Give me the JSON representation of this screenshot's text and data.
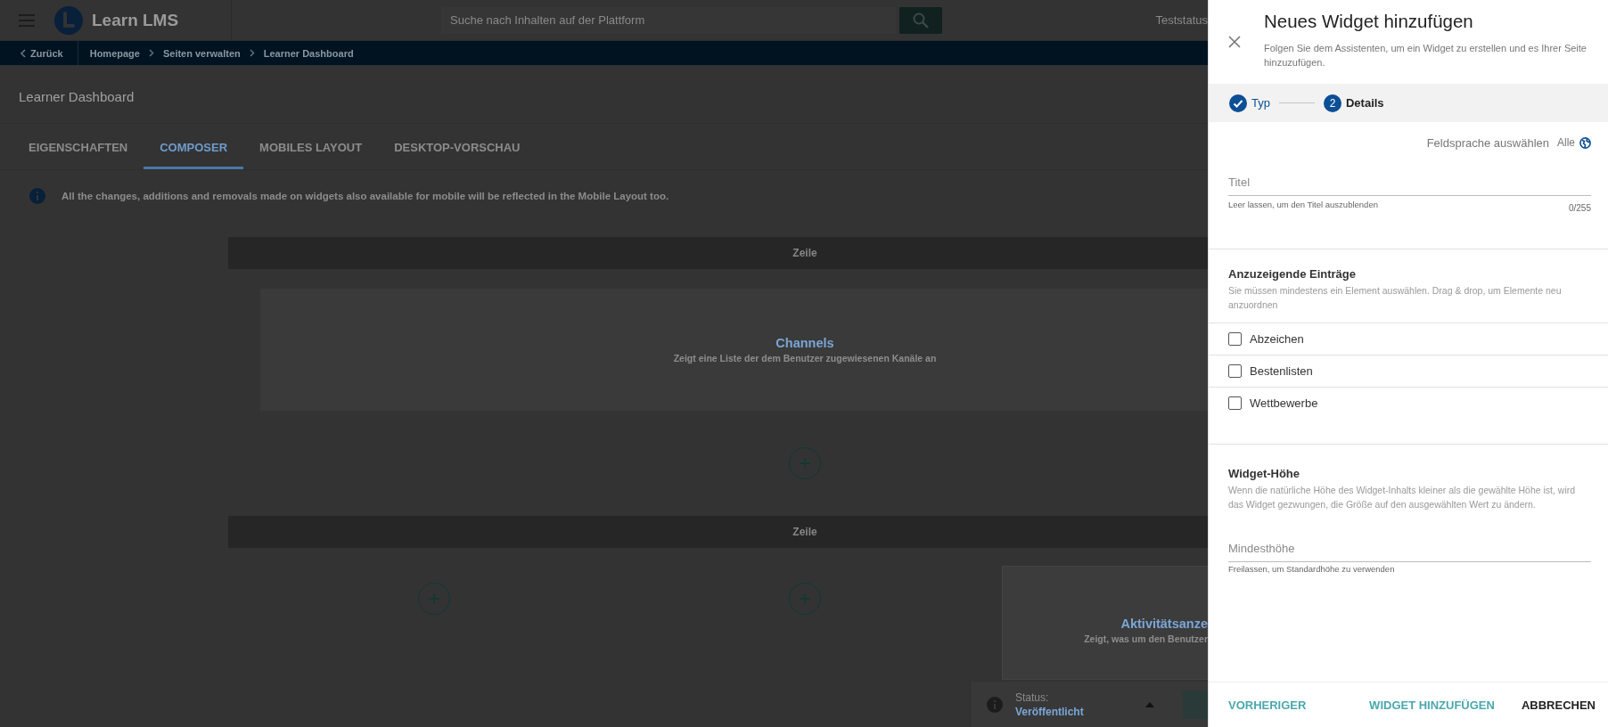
{
  "header": {
    "app_name": "Learn LMS",
    "search": {
      "placeholder": "Suche nach Inhalten auf der Plattform"
    },
    "user_status": "Teststatus"
  },
  "breadcrumb": {
    "back": "Zurück",
    "items": [
      "Homepage",
      "Seiten verwalten",
      "Learner Dashboard"
    ]
  },
  "page_title": "Learner Dashboard",
  "tabs": [
    {
      "label": "EIGENSCHAFTEN",
      "selected": false
    },
    {
      "label": "COMPOSER",
      "selected": true
    },
    {
      "label": "MOBILES LAYOUT",
      "selected": false
    },
    {
      "label": "DESKTOP-VORSCHAU",
      "selected": false
    }
  ],
  "info_message": "All the changes, additions and removals made on widgets also available for mobile will be reflected in the Mobile Layout too.",
  "rows": [
    {
      "label": "Zeile",
      "widget": {
        "title": "Channels",
        "description": "Zeigt eine Liste der dem Benutzer zugewiesenen Kanäle an"
      }
    },
    {
      "label": "Zeile",
      "widget": {
        "title": "Aktivitätsanze",
        "description": "Zeigt, was um den Benutzer"
      }
    }
  ],
  "status_bar": {
    "label": "Status:",
    "value": "Veröffentlicht"
  },
  "dialog": {
    "title": "Neues Widget hinzufügen",
    "subtitle": "Folgen Sie dem Assistenten, um ein Widget zu erstellen und es Ihrer Seite hinzuzufügen.",
    "steps": [
      {
        "label": "Typ",
        "completed": true
      },
      {
        "number": "2",
        "label": "Details",
        "completed": false
      }
    ],
    "language_label": "Feldsprache auswählen",
    "language_value": "Alle",
    "title_field": {
      "placeholder": "Titel",
      "hint": "Leer lassen, um den Titel auszublenden",
      "counter": "0/255"
    },
    "entries": {
      "heading": "Anzuzeigende Einträge",
      "description": "Sie müssen mindestens ein Element auswählen. Drag & drop, um Elemente neu anzuordnen",
      "items": [
        {
          "label": "Abzeichen",
          "checked": false
        },
        {
          "label": "Bestenlisten",
          "checked": false
        },
        {
          "label": "Wettbewerbe",
          "checked": false
        }
      ]
    },
    "height": {
      "heading": "Widget-Höhe",
      "description": "Wenn die natürliche Höhe des Widget-Inhalts kleiner als die gewählte Höhe ist, wird das Widget gezwungen, die Größe auf den ausgewählten Wert zu ändern.",
      "field": {
        "placeholder": "Mindesthöhe",
        "hint": "Freilassen, um Standardhöhe zu verwenden"
      }
    },
    "buttons": {
      "previous": "VORHERIGER",
      "add": "WIDGET HINZUFÜGEN",
      "cancel": "ABBRECHEN"
    }
  }
}
